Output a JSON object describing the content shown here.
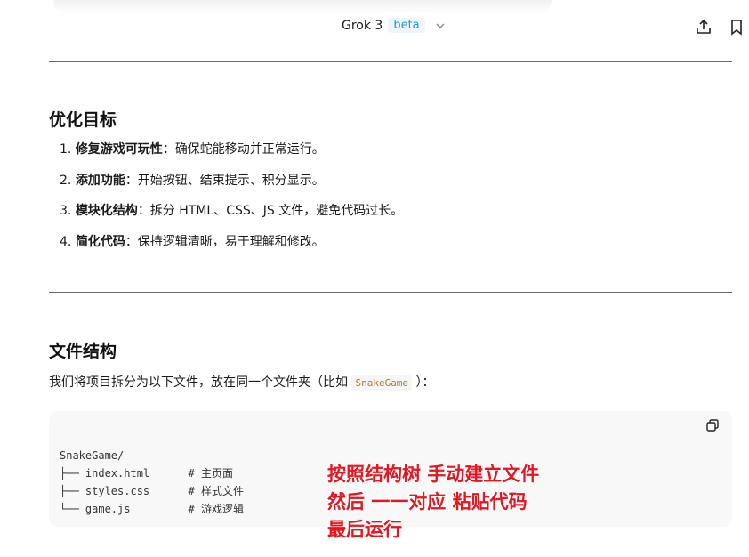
{
  "header": {
    "model_name": "Grok 3",
    "badge": "beta"
  },
  "sections": {
    "goals_title": "优化目标",
    "goals": [
      {
        "num": "1. ",
        "bold": "修复游戏可玩性",
        "rest": "：确保蛇能移动并正常运行。"
      },
      {
        "num": "2. ",
        "bold": "添加功能",
        "rest": "：开始按钮、结束提示、积分显示。"
      },
      {
        "num": "3. ",
        "bold": "模块化结构",
        "rest": "：拆分 HTML、CSS、JS 文件，避免代码过长。"
      },
      {
        "num": "4. ",
        "bold": "简化代码",
        "rest": "：保持逻辑清晰，易于理解和修改。"
      }
    ],
    "structure_title": "文件结构",
    "intro_before": "我们将项目拆分为以下文件，放在同一个文件夹（比如 ",
    "intro_code": "SnakeGame",
    "intro_after": " ）："
  },
  "code": {
    "line1": "SnakeGame/",
    "line2": "├── index.html      # 主页面",
    "line3": "├── styles.css      # 样式文件",
    "line4": "└── game.js         # 游戏逻辑"
  },
  "annotation": {
    "line1": "按照结构树  手动建立文件",
    "line2": "然后 一一对应 粘贴代码",
    "line3": "最后运行"
  }
}
